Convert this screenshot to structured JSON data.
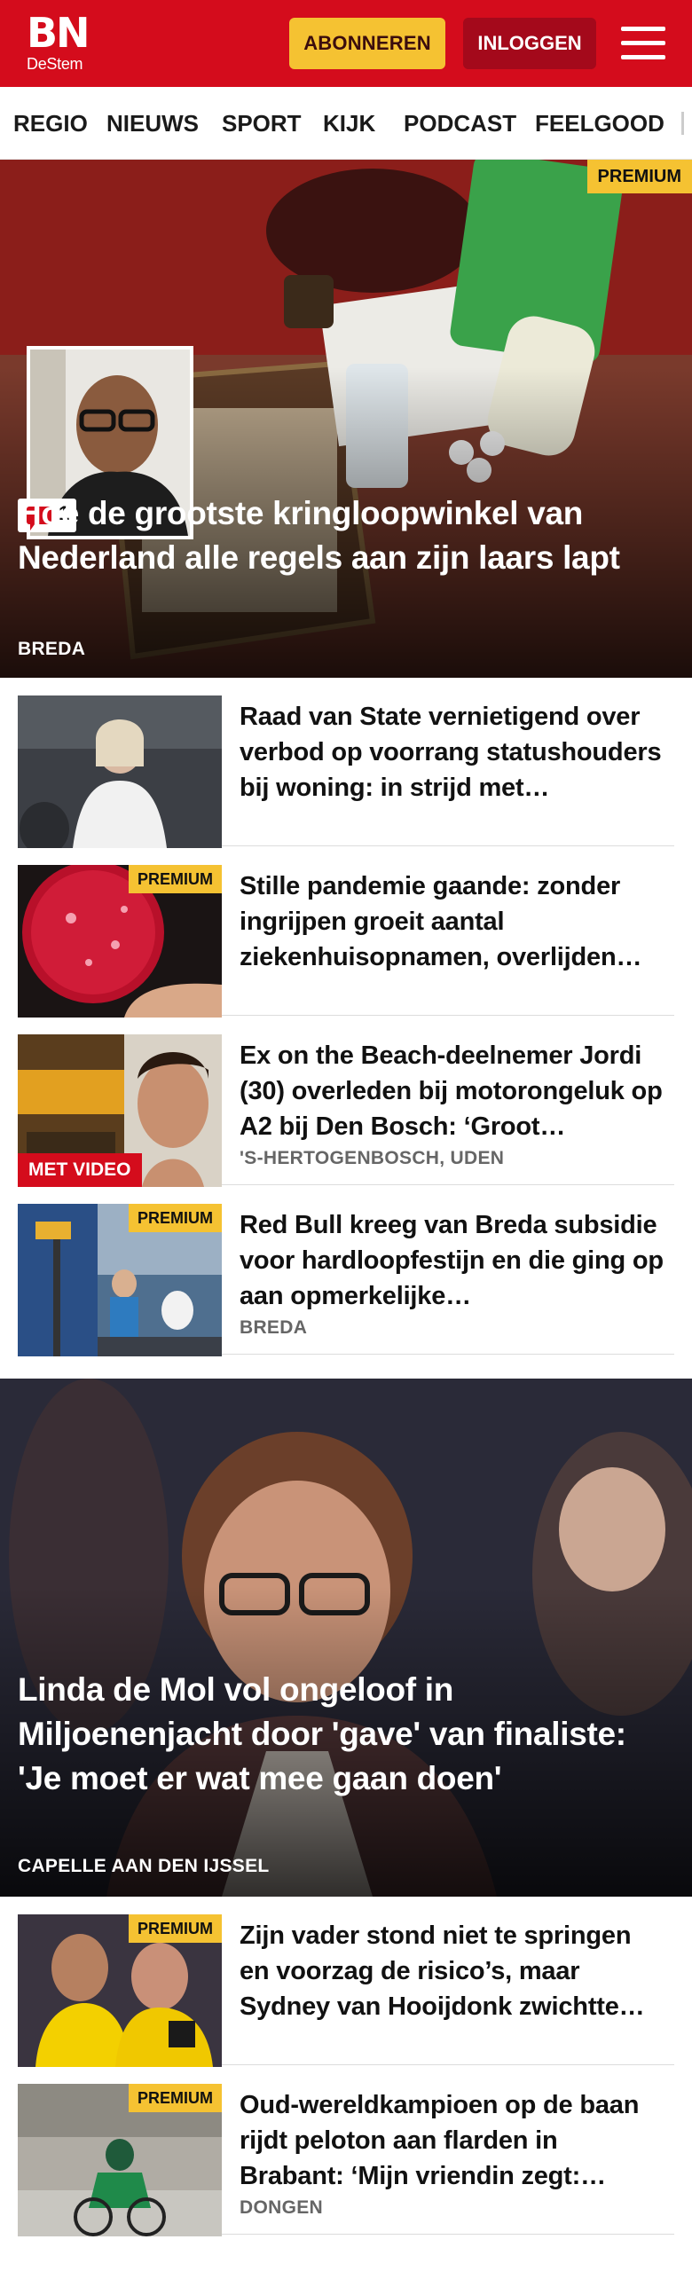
{
  "header": {
    "logo_main": "BN",
    "logo_sub": "DeStem",
    "subscribe_label": "ABONNEREN",
    "login_label": "INLOGGEN"
  },
  "nav": {
    "items": [
      "REGIO",
      "NIEUWS",
      "SPORT",
      "KIJK",
      "PODCAST",
      "FEELGOOD"
    ]
  },
  "hero1": {
    "premium": "PREMIUM",
    "comments": "1",
    "title": "Hoe de grootste kringloopwinkel van Nederland alle regels aan zijn laars lapt",
    "location": "BREDA"
  },
  "articles1": [
    {
      "title": "Raad van State vernietigend over verbod op voorrang statushou­ders bij woning: in strijd met…",
      "location": "",
      "badge": ""
    },
    {
      "title": "Stille pandemie gaande: zonder ingrijpen groeit aantal ziekenhuisopnamen, overlijden…",
      "location": "",
      "badge": "PREMIUM"
    },
    {
      "title": "Ex on the Beach-deelnemer Jordi (30) overleden bij motorongeluk op A2 bij Den Bosch: ‘Groot…",
      "location": "'S-HERTOGENBOSCH, UDEN",
      "badge": "MET VIDEO"
    },
    {
      "title": "Red Bull kreeg van Breda subsidie voor hardloopfestijn en die ging op aan opmerkelijke…",
      "location": "BREDA",
      "badge": "PREMIUM"
    }
  ],
  "hero2": {
    "title": "Linda de Mol vol ongeloof in Miljoenenjacht door 'gave' van finaliste: 'Je moet er wat mee gaan doen'",
    "location": "CAPELLE AAN DEN IJSSEL"
  },
  "articles2": [
    {
      "title": "Zijn vader stond niet te springen en voorzag de risico’s, maar Sydney van Hooijdonk zwichtte…",
      "location": "",
      "badge": "PREMIUM"
    },
    {
      "title": "Oud-wereldkampioen op de baan rijdt peloton aan flarden in Brabant: ‘Mijn vriendin zegt:…",
      "location": "DONGEN",
      "badge": "PREMIUM"
    }
  ],
  "colors": {
    "brand_red": "#d40c1c",
    "premium_yellow": "#f5c232",
    "login_dark_red": "#a4091b"
  }
}
